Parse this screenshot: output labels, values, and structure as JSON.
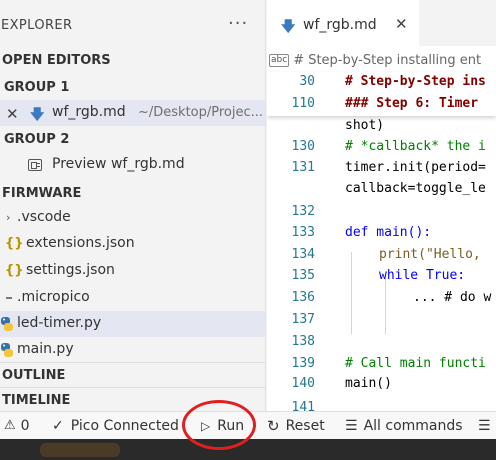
{
  "sidebar": {
    "title": "EXPLORER",
    "more": "···",
    "open_editors": {
      "title": "OPEN EDITORS",
      "group1": {
        "title": "GROUP 1",
        "file": "wf_rgb.md",
        "path": "~/Desktop/Projec..."
      },
      "group2": {
        "title": "GROUP 2",
        "file": "Preview wf_rgb.md"
      }
    },
    "firmware": {
      "title": "FIRMWARE",
      "items": [
        {
          "label": ".vscode"
        },
        {
          "label": "extensions.json"
        },
        {
          "label": "settings.json"
        },
        {
          "label": ".micropico"
        },
        {
          "label": "led-timer.py"
        },
        {
          "label": "main.py"
        }
      ]
    },
    "outline_title": "OUTLINE",
    "timeline_title": "TIMELINE"
  },
  "editor": {
    "tab": {
      "label": "wf_rgb.md",
      "close": "✕"
    },
    "breadcrumb": "# Step-by-Step installing ent",
    "sticky": [
      {
        "ln": "30",
        "text": "# Step-by-Step ins"
      },
      {
        "ln": "110",
        "text": "### Step 6: Timer"
      }
    ],
    "lines": [
      {
        "ln": "",
        "text": "shot)"
      },
      {
        "ln": "130",
        "text": "# *callback* the i"
      },
      {
        "ln": "131",
        "text": "timer.init(period="
      },
      {
        "ln": "",
        "text": "callback=toggle_le"
      },
      {
        "ln": "132",
        "text": ""
      },
      {
        "ln": "133",
        "text": "def main():"
      },
      {
        "ln": "134",
        "text": "print(\"Hello,"
      },
      {
        "ln": "135",
        "text": "while True:"
      },
      {
        "ln": "136",
        "text": "... # do w"
      },
      {
        "ln": "137",
        "text": ""
      },
      {
        "ln": "138",
        "text": ""
      },
      {
        "ln": "139",
        "text": "# Call main functi"
      },
      {
        "ln": "140",
        "text": "main()"
      },
      {
        "ln": "141",
        "text": ""
      }
    ]
  },
  "statusbar": {
    "warnings": "0",
    "connection": "Pico Connected",
    "run": "Run",
    "reset": "Reset",
    "all_commands": "All commands"
  },
  "colors": {
    "accent": "#3a7ac0",
    "highlight_ring": "#e02020"
  }
}
